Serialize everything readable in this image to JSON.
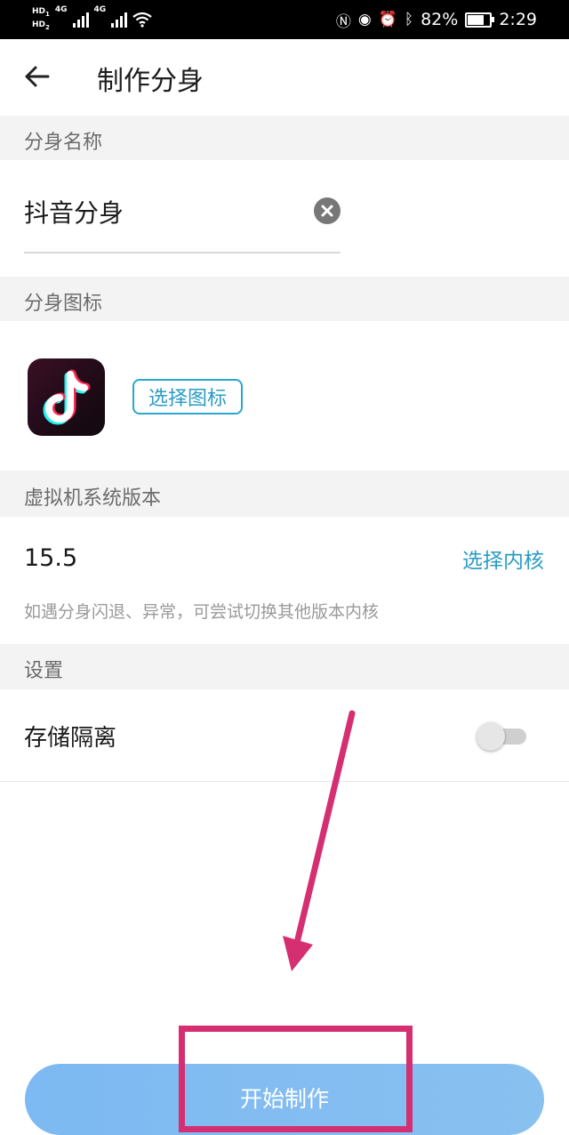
{
  "status_bar": {
    "network_left_top": "HD",
    "network_left_bottom": "HD",
    "sub_top": "1",
    "sub_bottom": "2",
    "net_type_1": "4G",
    "net_type_2": "4G",
    "battery": "82%",
    "battery_level": 0.82,
    "time": "2:29",
    "icons": [
      "hd-icon",
      "signal-icon",
      "wifi-icon",
      "nfc-icon",
      "eye-icon",
      "alarm-icon",
      "bluetooth-icon",
      "battery-icon"
    ]
  },
  "header": {
    "back_icon": "arrow-left-icon",
    "title": "制作分身"
  },
  "sections": {
    "name": "分身名称",
    "icon": "分身图标",
    "vm_version": "虚拟机系统版本",
    "settings": "设置"
  },
  "name_field": {
    "value": "抖音分身",
    "clear_icon": "clear-circle-icon"
  },
  "icon_picker": {
    "app_icon": "tiktok-logo-icon",
    "button_label": "选择图标"
  },
  "version": {
    "value": "15.5",
    "select_label": "选择内核",
    "hint": "如遇分身闪退、异常，可尝试切换其他版本内核"
  },
  "settings": {
    "storage_label": "存储隔离",
    "storage_enabled": false
  },
  "footer": {
    "start_label": "开始制作"
  },
  "colors": {
    "accent": "#2a9cc4",
    "button": "#7db9f2",
    "annotation": "#d52f72",
    "section_bg": "#f3f3f3"
  }
}
